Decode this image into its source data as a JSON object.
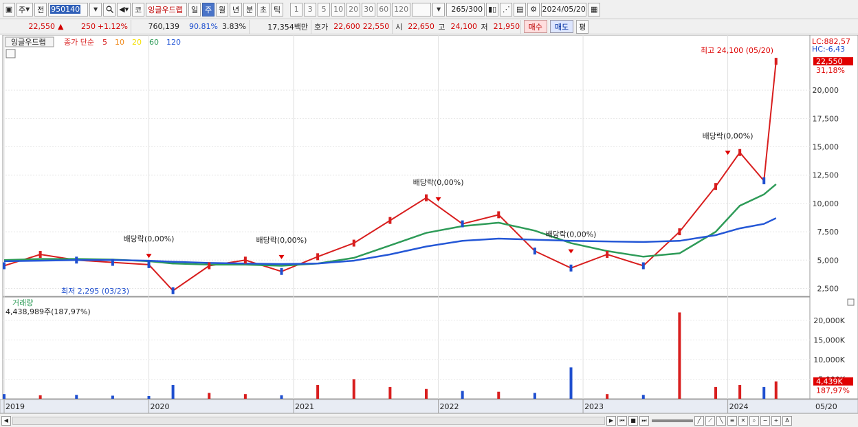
{
  "toolbar": {
    "market": "주",
    "prev_label": "전",
    "code": "950140",
    "kind": "코",
    "stock_name": "잉글우드랩",
    "periods": [
      "일",
      "주",
      "월",
      "년",
      "분",
      "초",
      "틱"
    ],
    "active_period": "주",
    "intervals": [
      "1",
      "3",
      "5",
      "10",
      "20",
      "30",
      "60",
      "120"
    ],
    "count_current": "265",
    "count_total": "/300",
    "date": "2024/05/20"
  },
  "quote": {
    "price": "22,550",
    "arrow": "▲",
    "change": "250",
    "change_pct": "+1.12%",
    "volume": "760,139",
    "vol_ratio": "90.81%",
    "turnover": "3.83%",
    "amount": "17,354백만",
    "ask_label": "호가",
    "ask": "22,600",
    "bid": "22,550",
    "open_label": "시",
    "open": "22,650",
    "high_label": "고",
    "high": "24,100",
    "low_label": "저",
    "low": "21,950",
    "buy_label": "매수",
    "sell_label": "매도",
    "eval_label": "평"
  },
  "legend": {
    "name": "잉글우드랩",
    "ma_label": "종가 단순",
    "periods": [
      "5",
      "10",
      "20",
      "60",
      "120"
    ],
    "colors": [
      "#d81e1e",
      "#f08a1c",
      "#f5e000",
      "#2e9b58",
      "#2457d6"
    ]
  },
  "volume_legend": {
    "title": "거래량",
    "value": "4,438,989주(187,97%)"
  },
  "corner": {
    "lc": "LC:882,57",
    "hc": "HC:-6,43"
  },
  "price_axis": {
    "ticks": [
      "20,000",
      "17,500",
      "15,000",
      "12,500",
      "10,000",
      "7,500",
      "5,000",
      "2,500"
    ],
    "current": "22,550",
    "current_pct": "31,18%"
  },
  "volume_axis": {
    "ticks": [
      "20,000K",
      "15,000K",
      "10,000K",
      "5,000K"
    ],
    "current": "4,439K",
    "current_pct": "187,97%"
  },
  "x_axis": {
    "labels": [
      "2019",
      "2020",
      "2021",
      "2022",
      "2023",
      "2024"
    ],
    "last": "05/20"
  },
  "annotations": {
    "high": "최고 24,100 (05/20)",
    "low": "최저 2,295 (03/23)",
    "dividend": "배당락(0,00%)"
  },
  "chart_data": {
    "type": "line",
    "x": [
      "2019-01",
      "2019-04",
      "2019-07",
      "2019-10",
      "2020-01",
      "2020-03",
      "2020-06",
      "2020-09",
      "2020-12",
      "2021-03",
      "2021-06",
      "2021-09",
      "2021-12",
      "2022-03",
      "2022-06",
      "2022-09",
      "2022-12",
      "2023-03",
      "2023-06",
      "2023-09",
      "2023-12",
      "2024-02",
      "2024-04",
      "2024-05"
    ],
    "series": [
      {
        "name": "종가",
        "values": [
          4500,
          5500,
          5000,
          4800,
          4600,
          2295,
          4500,
          5000,
          4000,
          5300,
          6500,
          8500,
          10500,
          8200,
          9000,
          5800,
          4300,
          5500,
          4500,
          7500,
          11500,
          14500,
          12000,
          22550
        ]
      },
      {
        "name": "60",
        "values": [
          5000,
          5100,
          5100,
          5050,
          4900,
          4700,
          4600,
          4600,
          4500,
          4700,
          5200,
          6300,
          7400,
          8000,
          8300,
          7600,
          6500,
          5800,
          5300,
          5600,
          7500,
          9800,
          10800,
          11700
        ]
      },
      {
        "name": "120",
        "values": [
          4900,
          4950,
          5000,
          5000,
          4950,
          4850,
          4750,
          4700,
          4650,
          4700,
          4950,
          5500,
          6200,
          6700,
          6900,
          6800,
          6700,
          6650,
          6600,
          6700,
          7200,
          7800,
          8200,
          8700
        ]
      }
    ],
    "volume_k": [
      1200,
      900,
      1000,
      800,
      700,
      3500,
      1500,
      1200,
      900,
      3500,
      5000,
      3000,
      2500,
      2000,
      1800,
      1500,
      8000,
      1200,
      1000,
      22000,
      3000,
      3500,
      3000,
      4439
    ],
    "ylim": [
      1800,
      24500
    ]
  }
}
